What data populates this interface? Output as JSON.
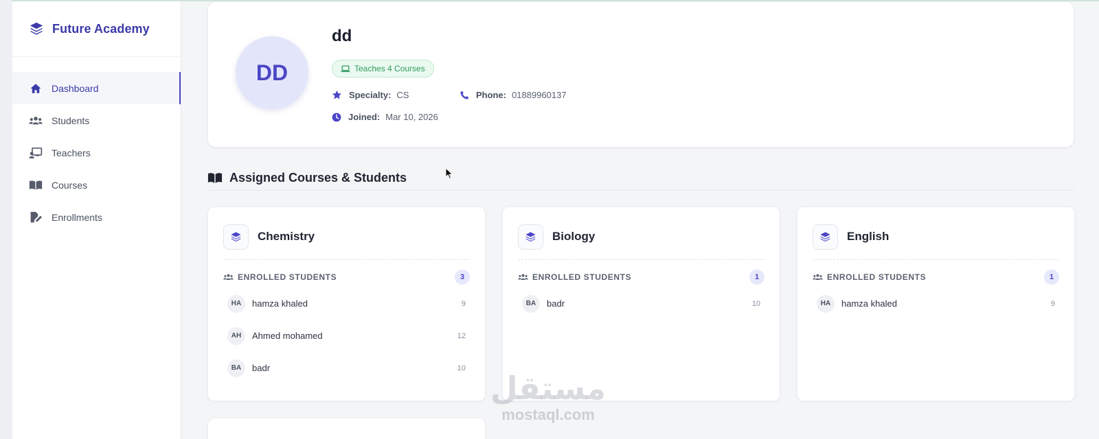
{
  "brand": {
    "name": "Future Academy"
  },
  "sidebar": {
    "items": [
      {
        "label": "Dashboard",
        "icon": "home-icon",
        "active": true
      },
      {
        "label": "Students",
        "icon": "users-icon"
      },
      {
        "label": "Teachers",
        "icon": "chalkboard-teacher-icon"
      },
      {
        "label": "Courses",
        "icon": "book-icon"
      },
      {
        "label": "Enrollments",
        "icon": "edit-document-icon"
      }
    ]
  },
  "profile": {
    "initials": "DD",
    "name": "dd",
    "badge": "Teaches 4 Courses",
    "specialty_label": "Specialty:",
    "specialty_value": "CS",
    "phone_label": "Phone:",
    "phone_value": "01889960137",
    "joined_label": "Joined:",
    "joined_value": "Mar 10, 2026"
  },
  "section": {
    "title": "Assigned Courses & Students"
  },
  "courses": [
    {
      "name": "Chemistry",
      "enrolled_label": "ENROLLED STUDENTS",
      "count": "3",
      "students": [
        {
          "initials": "HA",
          "name": "hamza khaled",
          "value": "9"
        },
        {
          "initials": "AH",
          "name": "Ahmed mohamed",
          "value": "12"
        },
        {
          "initials": "BA",
          "name": "badr",
          "value": "10"
        }
      ]
    },
    {
      "name": "Biology",
      "enrolled_label": "ENROLLED STUDENTS",
      "count": "1",
      "students": [
        {
          "initials": "BA",
          "name": "badr",
          "value": "10"
        }
      ]
    },
    {
      "name": "English",
      "enrolled_label": "ENROLLED STUDENTS",
      "count": "1",
      "students": [
        {
          "initials": "HA",
          "name": "hamza khaled",
          "value": "9"
        }
      ]
    }
  ],
  "watermark": {
    "arabic": "مستقل",
    "latin": "mostaql.com"
  },
  "colors": {
    "accent": "#4b45c6",
    "brand": "#3b3aa8",
    "badge_green": "#2f9a5d"
  }
}
